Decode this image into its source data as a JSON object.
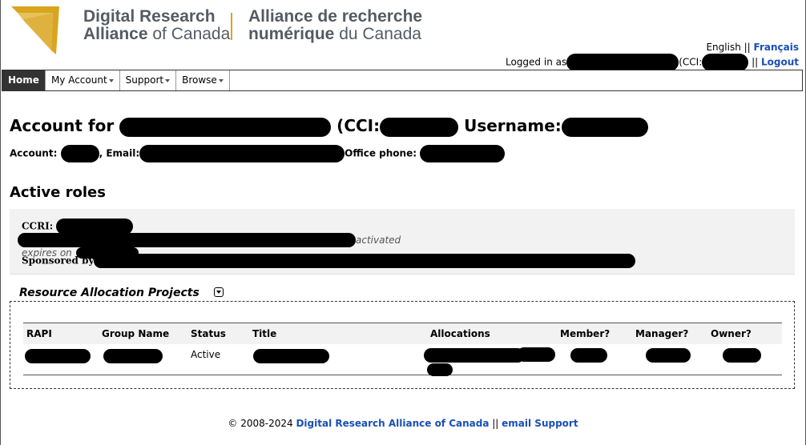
{
  "brand": {
    "en_bold": "Digital Research",
    "en_line2_bold": "Alliance",
    "en_line2_rest": " of Canada",
    "fr_bold": "Alliance de recherche",
    "fr_line2_bold": "numérique",
    "fr_line2_rest": " du Canada",
    "accent_color": "#d9a51e"
  },
  "language": {
    "english": "English",
    "sep": " || ",
    "francais": "Français"
  },
  "session": {
    "logged_in_prefix": "Logged in as",
    "cci_prefix": "(CCI:",
    "sep": " || ",
    "logout": "Logout"
  },
  "nav": {
    "items": [
      {
        "label": "Home",
        "active": true
      },
      {
        "label": "My Account",
        "dropdown": true
      },
      {
        "label": "Support",
        "dropdown": true
      },
      {
        "label": "Browse",
        "dropdown": true
      }
    ]
  },
  "account": {
    "title_prefix": "Account for",
    "cci_label": "(CCI:",
    "username_label": "Username:",
    "account_label": "Account:",
    "email_label": ", Email:",
    "phone_label": "Office phone:"
  },
  "roles": {
    "heading": "Active roles",
    "ccri_label": "CCRI:",
    "activated": "activated",
    "expires_on": "expires on",
    "sponsored_by": "Sponsored by"
  },
  "rap": {
    "heading": "Resource Allocation Projects",
    "columns": [
      "RAPI",
      "Group Name",
      "Status",
      "Title",
      "Allocations",
      "Member?",
      "Manager?",
      "Owner?"
    ],
    "rows": [
      {
        "status": "Active"
      }
    ]
  },
  "footer": {
    "copyright": "© 2008-2024 ",
    "org_link": "Digital Research Alliance of Canada",
    "sep": " || ",
    "support_link": "email Support"
  },
  "colors": {
    "link": "#1a4fb5",
    "nav_active_bg": "#333333",
    "panel_bg": "#f2f2f2"
  }
}
